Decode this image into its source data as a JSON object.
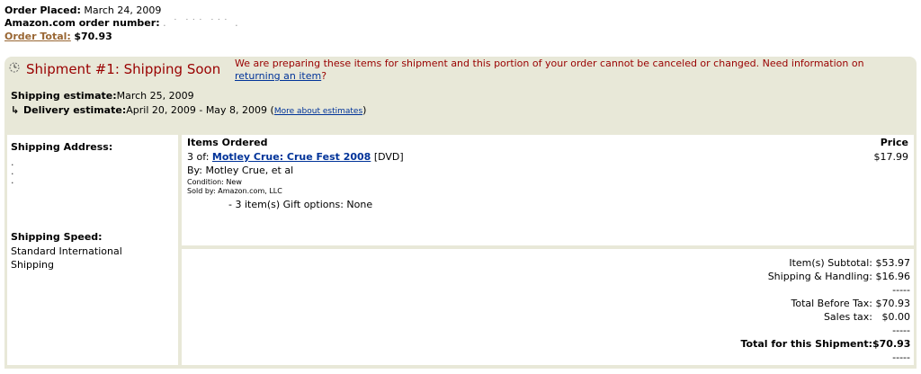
{
  "order": {
    "placed_label": "Order Placed:",
    "placed_value": "March 24, 2009",
    "number_label": "Amazon.com order number:",
    "number_value": ". ˙ ˙˙˙ ˙˙˙ .",
    "total_label": "Order Total:",
    "total_value": "$70.93"
  },
  "shipment": {
    "icon": "clock-icon",
    "title": "Shipment #1: Shipping Soon",
    "message": "We are preparing these items for shipment and this portion of your order cannot be canceled or changed. Need information on ",
    "message_link": "returning an item",
    "message_end": "?",
    "shipping_estimate_label": "Shipping estimate:",
    "shipping_estimate_value": "March 25, 2009",
    "delivery_estimate_label": "Delivery estimate:",
    "delivery_estimate_value": "April 20, 2009 - May 8, 2009",
    "more_open": "(",
    "more_link": "More about estimates",
    "more_close": ")"
  },
  "left": {
    "address_label": "Shipping Address:",
    "address_lines": [
      ".",
      ".",
      "."
    ],
    "speed_label": "Shipping Speed:",
    "speed_value": "Standard International Shipping"
  },
  "items": {
    "header": "Items Ordered",
    "price_header": "Price",
    "list": [
      {
        "qty": "3 of:",
        "title": "Motley Crue: Crue Fest 2008",
        "format": "[DVD]",
        "by": "By: Motley Crue, et al",
        "condition": "Condition: New",
        "seller": "Sold by: Amazon.com, LLC",
        "gift": "- 3 item(s) Gift options: None",
        "price": "$17.99"
      }
    ]
  },
  "totals": {
    "subtotal_label": "Item(s) Subtotal:",
    "subtotal_value": "$53.97",
    "shipping_label": "Shipping & Handling:",
    "shipping_value": "$16.96",
    "dashes": "-----",
    "before_tax_label": "Total Before Tax:",
    "before_tax_value": "$70.93",
    "tax_label": "Sales tax:",
    "tax_value": "$0.00",
    "grand_label": "Total for this Shipment:",
    "grand_value": "$70.93"
  }
}
